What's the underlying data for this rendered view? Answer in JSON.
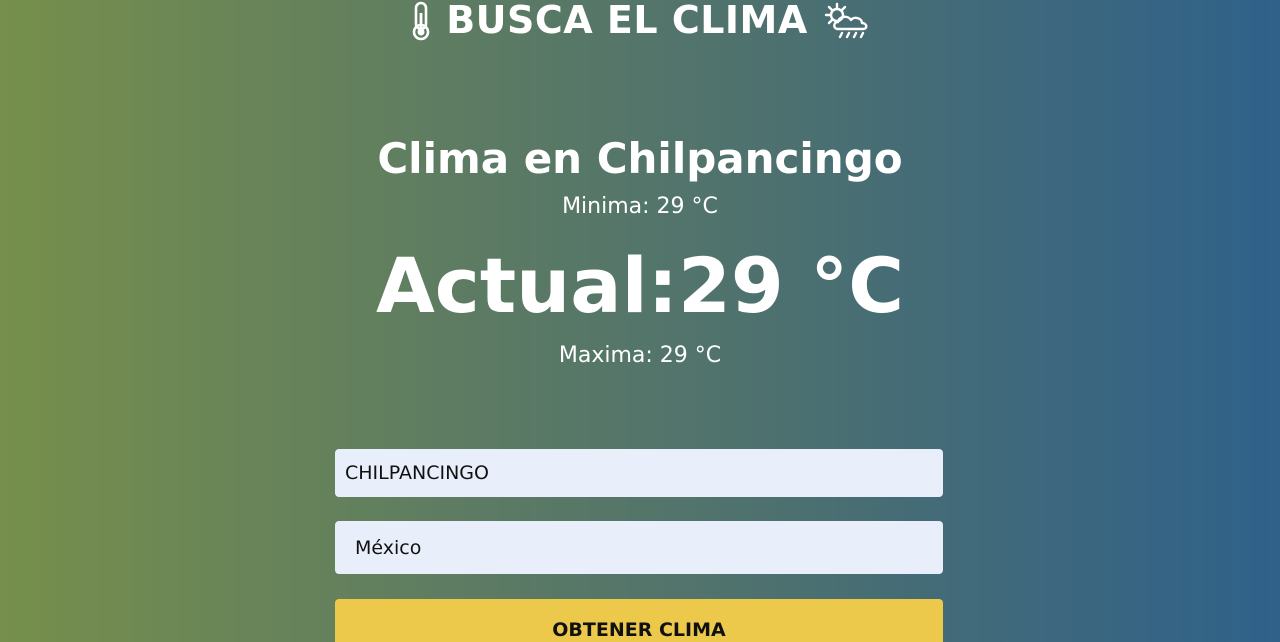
{
  "header": {
    "title": "BUSCA EL CLIMA",
    "left_icon": "thermometer-icon",
    "right_icon": "sun-behind-rain-cloud-icon"
  },
  "weather": {
    "heading": "Clima en Chilpancingo",
    "min_label": "Minima: 29 °C",
    "current_label": "Actual:29 °C",
    "max_label": "Maxima: 29 °C"
  },
  "form": {
    "city_value": "CHILPANCINGO",
    "country_selected": "México",
    "submit_label": "OBTENER CLIMA"
  },
  "colors": {
    "gradient_left": "#768f4b",
    "gradient_right": "#2f628a",
    "input_bg": "#e8effb",
    "button_bg": "#ecc94b",
    "text": "#ffffff"
  }
}
